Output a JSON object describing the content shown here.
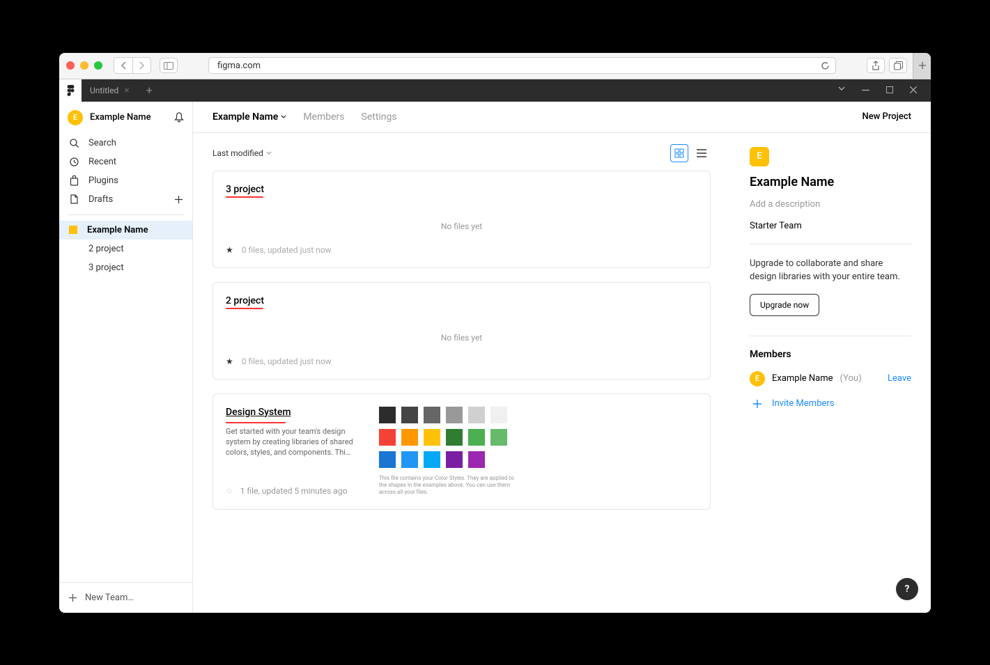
{
  "browser": {
    "url": "figma.com"
  },
  "tabbar": {
    "tab_title": "Untitled"
  },
  "sidebar": {
    "username": "Example Name",
    "items": {
      "search": "Search",
      "recent": "Recent",
      "plugins": "Plugins",
      "drafts": "Drafts"
    },
    "team": {
      "name": "Example Name",
      "projects": [
        "2 project",
        "3 project"
      ]
    },
    "footer": "New Team…"
  },
  "header": {
    "title": "Example Name",
    "members": "Members",
    "settings": "Settings",
    "new_project": "New Project"
  },
  "filter": {
    "label": "Last modified"
  },
  "projects": [
    {
      "title": "3 project",
      "no_files": "No files yet",
      "footer": "0 files, updated just now",
      "starred": true
    },
    {
      "title": "2 project",
      "no_files": "No files yet",
      "footer": "0 files, updated just now",
      "starred": true
    }
  ],
  "design_system": {
    "title": "Design System",
    "desc": "Get started with your team's design system by creating libraries of shared colors, styles, and components. Thi…",
    "footer": "1 file, updated 5 minutes ago",
    "caption": "This file contains your Color Styles. They are applied to the shapes in the examples above. You can use them across all your files.",
    "colors_row1": [
      "#2c2c2c",
      "#444444",
      "#666666",
      "#999999",
      "#d0d0d0",
      "#f0f0f0"
    ],
    "colors_row2": [
      "#f44336",
      "#ff9800",
      "#ffc107",
      "#2e7d32",
      "#4caf50",
      "#66bb6a"
    ],
    "colors_row3": [
      "#1976d2",
      "#2196f3",
      "#03a9f4",
      "#7b1fa2",
      "#9c27b0"
    ]
  },
  "right_panel": {
    "title": "Example Name",
    "desc_placeholder": "Add a description",
    "plan": "Starter Team",
    "upgrade_text": "Upgrade to collaborate and share design libraries with your entire team.",
    "upgrade_btn": "Upgrade now",
    "members_title": "Members",
    "member_name": "Example Name",
    "member_you": "(You)",
    "leave": "Leave",
    "invite": "Invite Members"
  }
}
